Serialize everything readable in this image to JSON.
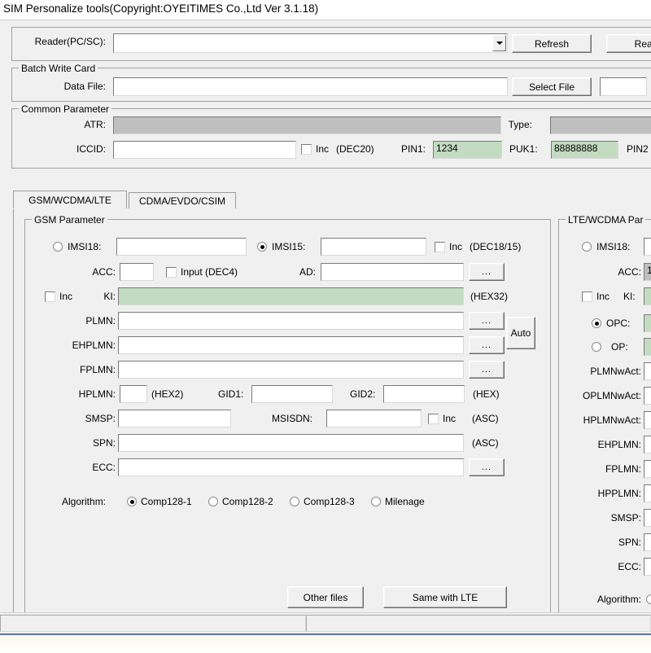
{
  "window": {
    "title": "SIM Personalize tools(Copyright:OYEITIMES Co.,Ltd Ver 3.1.18)"
  },
  "reader_row": {
    "label": "Reader(PC/SC):",
    "value": "",
    "refresh_label": "Refresh",
    "read_label": "Read"
  },
  "batch_write_card": {
    "caption": "Batch Write Card",
    "data_file_label": "Data File:",
    "data_file_value": "",
    "select_file_label": "Select File",
    "count_value": ""
  },
  "common_parameter": {
    "caption": "Common Parameter",
    "atr_label": "ATR:",
    "atr_value": "",
    "type_label": "Type:",
    "type_value": "",
    "iccid_label": "ICCID:",
    "iccid_value": "",
    "iccid_inc_label": "Inc",
    "iccid_hint": "(DEC20)",
    "pin1_label": "PIN1:",
    "pin1_value": "1234",
    "puk1_label": "PUK1:",
    "puk1_value": "88888888",
    "pin2_label": "PIN2"
  },
  "tabs": [
    {
      "label": "GSM/WCDMA/LTE",
      "selected": true
    },
    {
      "label": "CDMA/EVDO/CSIM",
      "selected": false
    }
  ],
  "gsm_parameter": {
    "caption": "GSM Parameter",
    "imsi18_label": "IMSI18:",
    "imsi18_value": "",
    "imsi18_selected": false,
    "imsi15_label": "IMSI15:",
    "imsi15_value": "",
    "imsi15_selected": true,
    "imsi_inc_label": "Inc",
    "imsi_hint": "(DEC18/15)",
    "acc_label": "ACC:",
    "acc_value": "",
    "acc_input_label": "Input (DEC4)",
    "ad_label": "AD:",
    "ad_value": "",
    "ki_inc_label": "Inc",
    "ki_label": "KI:",
    "ki_value": "",
    "ki_hint": "(HEX32)",
    "plmn_label": "PLMN:",
    "plmn_value": "",
    "ehplmn_label": "EHPLMN:",
    "ehplmn_value": "",
    "fplmn_label": "FPLMN:",
    "fplmn_value": "",
    "auto_label": "Auto",
    "hplmn_label": "HPLMN:",
    "hplmn_value": "",
    "hplmn_hint": "(HEX2)",
    "gid1_label": "GID1:",
    "gid1_value": "",
    "gid2_label": "GID2:",
    "gid2_value": "",
    "gid_hint": "(HEX)",
    "smsp_label": "SMSP:",
    "smsp_value": "",
    "msisdn_label": "MSISDN:",
    "msisdn_value": "",
    "msisdn_inc_label": "Inc",
    "msisdn_hint": "(ASC)",
    "spn_label": "SPN:",
    "spn_value": "",
    "spn_hint": "(ASC)",
    "ecc_label": "ECC:",
    "ecc_value": "",
    "ellipsis_label": "...",
    "algorithm_label": "Algorithm:",
    "algorithms": [
      {
        "label": "Comp128-1",
        "selected": true
      },
      {
        "label": "Comp128-2",
        "selected": false
      },
      {
        "label": "Comp128-3",
        "selected": false
      },
      {
        "label": "Milenage",
        "selected": false
      }
    ],
    "other_files_label": "Other files",
    "same_with_lte_label": "Same with LTE"
  },
  "lte_parameter": {
    "caption": "LTE/WCDMA Par",
    "imsi18_label": "IMSI18:",
    "imsi18_selected": false,
    "acc_label": "ACC:",
    "acc_value": "1",
    "ki_inc_label": "Inc",
    "ki_label": "KI:",
    "opc_label": "OPC:",
    "opc_selected": true,
    "op_label": "OP:",
    "op_selected": false,
    "plmnwact_label": "PLMNwAct:",
    "oplmnwact_label": "OPLMNwAct:",
    "hplmnwact_label": "HPLMNwAct:",
    "ehplmn_label": "EHPLMN:",
    "fplmn_label": "FPLMN:",
    "hpplmn_label": "HPPLMN:",
    "smsp_label": "SMSP:",
    "spn_label": "SPN:",
    "ecc_label": "ECC:",
    "algorithm_label": "Algorithm:"
  },
  "statusbar": {
    "left_text": "",
    "right_text": ""
  },
  "colors": {
    "field_green": "#c3dcc1",
    "readonly_grey": "#bfbfbf",
    "dialog_face": "#f0f0f0"
  }
}
